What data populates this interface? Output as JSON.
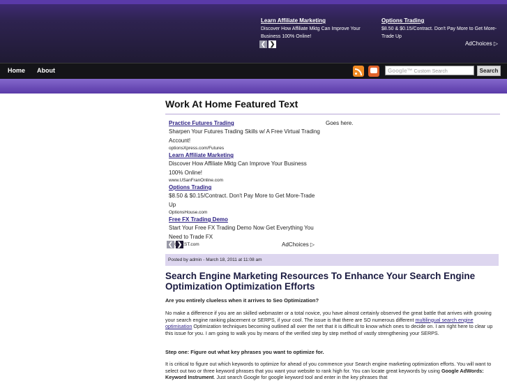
{
  "top_ad": {
    "ad1": {
      "title": "Learn Affiliate Marketing",
      "desc": "Discover How Affiliate Mktg Can Improve Your Business 100% Online!"
    },
    "ad2": {
      "title": "Options Trading",
      "desc": "$8.50 & $0.15/Contract. Don't Pay More to Get More-Trade Up"
    },
    "adchoices": "AdChoices ▷"
  },
  "nav": {
    "home": "Home",
    "about": "About"
  },
  "search": {
    "placeholder": "Custom Search",
    "google": "Google™",
    "button": "Search"
  },
  "featured": {
    "title": "Work At Home Featured Text",
    "goes_here": "Goes here."
  },
  "ads": [
    {
      "title": "Practice Futures Trading",
      "desc": "Sharpen Your Futures Trading Skills w/ A Free Virtual Trading Account!",
      "url": "optionsXpress.com/Futures"
    },
    {
      "title": "Learn Affiliate Marketing",
      "desc": "Discover How Affiliate Mktg Can Improve Your Business 100% Online!",
      "url": "www.USanFranOnline.com"
    },
    {
      "title": "Options Trading",
      "desc": "$8.50 & $0.15/Contract. Don't Pay More to Get More-Trade Up",
      "url": "OptionsHouse.com"
    },
    {
      "title": "Free FX Trading Demo",
      "desc": "Start Your Free FX Trading Demo Now Get Everything You Need to Trade FX",
      "url": "PFGBEST.com"
    }
  ],
  "ads_adchoices": "AdChoices ▷",
  "posted": "Posted by admin - March 18, 2011 at 11:08 am",
  "article": {
    "title": "Search Engine Marketing Resources To Enhance Your Search Engine Optimization Optimization Efforts",
    "q1": "Are you entirely clueless when it arrives to Seo Optimization?",
    "p1_a": "No make a difference if you are an skilled webmaster or a total novice, you have almost certainly observed the great battle that arrives with growing your search engine ranking placement or SERPS, if your cool. The issue is that there are SO numerous different ",
    "p1_link": "multilingual search engine optimisation",
    "p1_b": " Optimization techniques becoming outlined all over the net that it is difficult to know which ones to decide on. I am right here to clear up this issue for you. I am going to walk you by means of the verified step by step method of vastly strengthening your SERPS.",
    "step1": "Step one: Figure out what key phrases you want to optimize for.",
    "p2_a": "It is critical to figure out which keywords to optimize for ahead of you commence your Search engine marketing optimization efforts. You will want to select out two or three keyword phrases that you want your website to rank high for. You can locate great keywords by using ",
    "p2_bold": "Google AdWords: Keyword Instrument",
    "p2_b": ". Just search Google for google keyword tool and enter in the key phrases that"
  }
}
